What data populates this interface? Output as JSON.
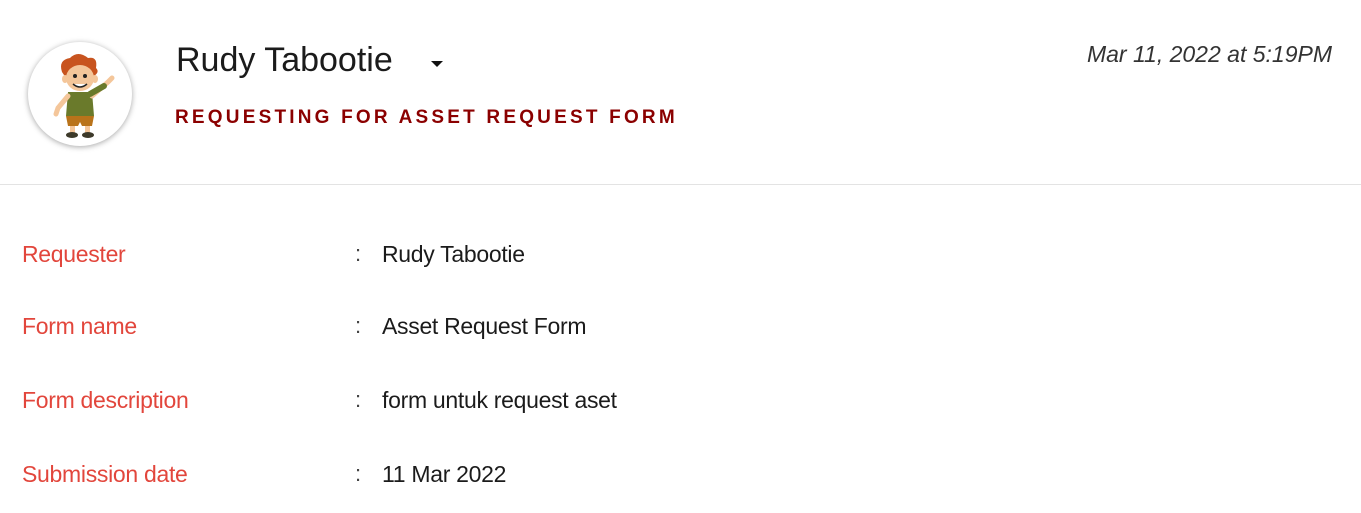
{
  "header": {
    "user_name": "Rudy Tabootie",
    "subtitle": "REQUESTING FOR ASSET REQUEST FORM",
    "timestamp": "Mar 11, 2022 at 5:19PM"
  },
  "details": [
    {
      "label": "Requester",
      "colon": ":",
      "value": "Rudy Tabootie"
    },
    {
      "label": "Form name",
      "colon": ":",
      "value": "Asset Request Form"
    },
    {
      "label": "Form description",
      "colon": ":",
      "value": "form untuk request aset"
    },
    {
      "label": "Submission date",
      "colon": ":",
      "value": "11 Mar 2022"
    }
  ],
  "colors": {
    "label": "#e2463c",
    "subtitle": "#8b0000",
    "divider": "#e3e3e3"
  }
}
